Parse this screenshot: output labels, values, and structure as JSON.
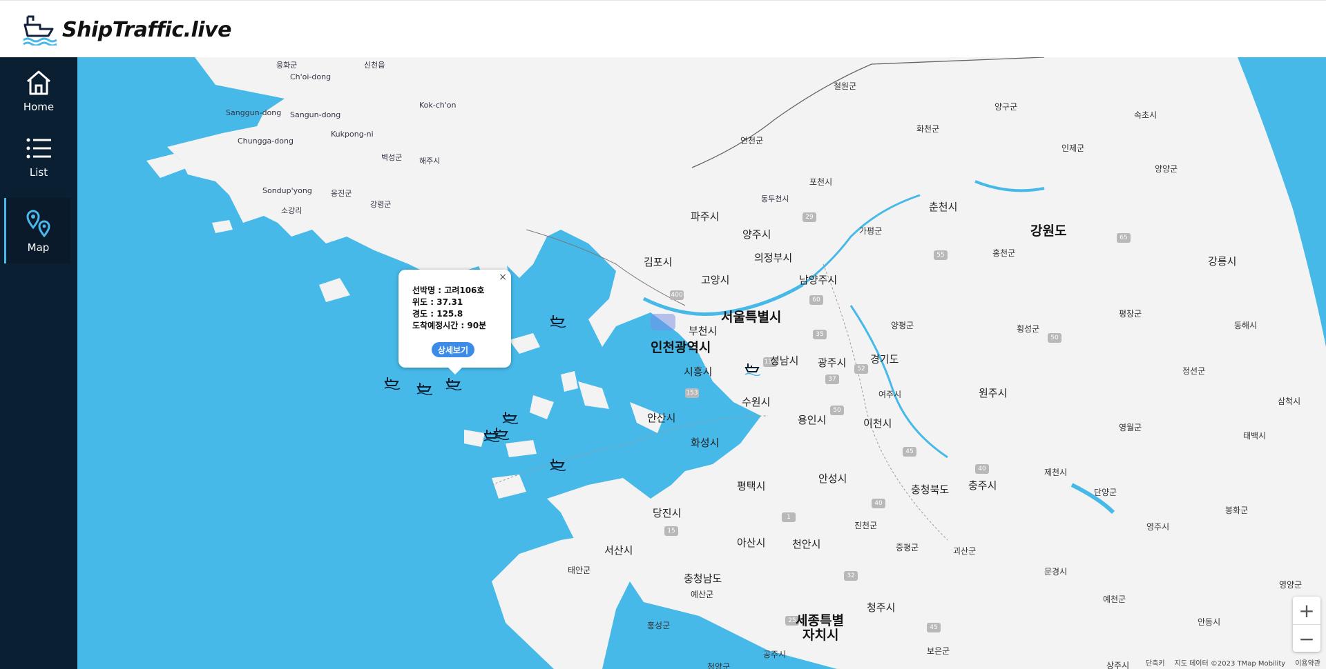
{
  "app": {
    "title": "ShipTraffic.live"
  },
  "sidebar": {
    "items": [
      {
        "label": "Home",
        "icon": "home-icon"
      },
      {
        "label": "List",
        "icon": "list-icon"
      },
      {
        "label": "Map",
        "icon": "map-pins-icon",
        "active": true
      }
    ]
  },
  "popup": {
    "name_line": "선박명 : 고려106호",
    "lat_line": "위도 : 37.31",
    "lon_line": "경도 : 125.8",
    "eta_line": "도착예정시간 : 90분",
    "button": "상세보기",
    "close": "×"
  },
  "map": {
    "labels": {
      "l1": "웅화군",
      "l2": "신천읍",
      "l3": "Ch'oi-dong",
      "l4": "철원군",
      "l5": "양구군",
      "l6": "속초시",
      "l7": "Sanggun-dong",
      "l8": "Sangun-dong",
      "l9": "Kok-ch'on",
      "l10": "화천군",
      "l11": "Chungga-dong",
      "l12": "Kukpong-ni",
      "l13": "연천군",
      "l14": "인제군",
      "l15": "벽성군",
      "l16": "해주시",
      "l17": "양양군",
      "l18": "Sondup'yong",
      "l19": "옹진군",
      "l20": "포천시",
      "l21": "동두천시",
      "l22": "강령군",
      "l23": "소강리",
      "l24": "춘천시",
      "l25": "파주시",
      "l26": "가평군",
      "l27": "강원도",
      "l28": "양주시",
      "l29": "의정부시",
      "l30": "홍천군",
      "l31": "강릉시",
      "l32": "김포시",
      "l33": "고양시",
      "l34": "남양주시",
      "l35": "서울특별시",
      "l36": "평창군",
      "l37": "부천시",
      "l38": "양평군",
      "l39": "횡성군",
      "l40": "동해시",
      "l41": "인천광역시",
      "l42": "성남시",
      "l43": "광주시",
      "l44": "경기도",
      "l45": "시흥시",
      "l46": "정선군",
      "l47": "여주시",
      "l48": "원주시",
      "l49": "수원시",
      "l50": "삼척시",
      "l51": "안산시",
      "l52": "용인시",
      "l53": "이천시",
      "l54": "영월군",
      "l55": "화성시",
      "l56": "태백시",
      "l57": "안성시",
      "l58": "제천시",
      "l59": "평택시",
      "l60": "충청북도",
      "l61": "충주시",
      "l62": "단양군",
      "l63": "당진시",
      "l64": "봉화군",
      "l65": "진천군",
      "l66": "영주시",
      "l67": "아산시",
      "l68": "천안시",
      "l69": "증평군",
      "l70": "서산시",
      "l71": "괴산군",
      "l72": "태안군",
      "l73": "충청남도",
      "l74": "문경시",
      "l75": "영양군",
      "l76": "예산군",
      "l77": "예천군",
      "l78": "청주시",
      "l79": "안동시",
      "l80": "홍성군",
      "l81": "세종특별",
      "l82": "자치시",
      "l83": "보은군",
      "l84": "공주시",
      "l85": "청양군",
      "l86": "상주시"
    },
    "footer": {
      "scale": "단축키",
      "credit": "지도 데이터 ©2023 TMap Mobility",
      "terms": "이용약관"
    },
    "zoom_in": "+",
    "zoom_out": "−"
  },
  "colors": {
    "sea": "#47b9e9",
    "land": "#f3f3f3",
    "sidebar": "#0b1f33",
    "accent": "#4ab8ea",
    "button": "#3c8be8"
  }
}
